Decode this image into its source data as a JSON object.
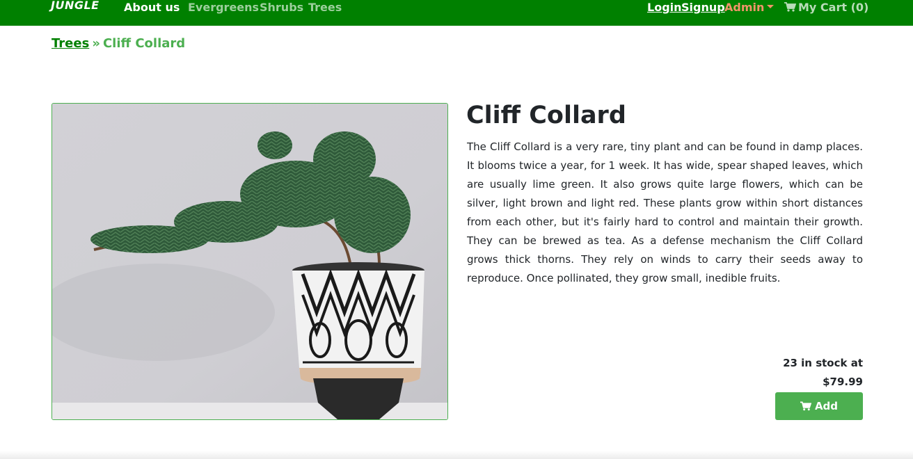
{
  "navbar": {
    "brand": "JUNGLE",
    "about": "About us",
    "categories": [
      "Evergreens",
      "Shrubs",
      "Trees"
    ],
    "login": "Login",
    "signup": "Signup",
    "admin": "Admin",
    "cart_label": "My Cart (0)",
    "colors": {
      "background": "#008000",
      "category_link": "#9ccf9c",
      "admin": "#f0956a"
    }
  },
  "breadcrumb": {
    "parent": "Trees",
    "separator": "»",
    "current": "Cliff Collard"
  },
  "product": {
    "name": "Cliff Collard",
    "description": "The Cliff Collard is a very rare, tiny plant and can be found in damp places. It blooms twice a year, for 1 week. It has wide, spear shaped leaves, which are usually lime green. It also grows quite large flowers, which can be silver, light brown and light red. These plants grow within short distances from each other, but it's fairly hard to control and maintain their growth. They can be brewed as tea. As a defense mechanism the Cliff Collard grows thick thorns. They rely on winds to carry their seeds away to reproduce. Once pollinated, they grow small, inedible fruits.",
    "stock_text": "23 in stock at",
    "price": "$79.99",
    "add_label": "Add",
    "colors": {
      "button": "#4caf50"
    }
  }
}
